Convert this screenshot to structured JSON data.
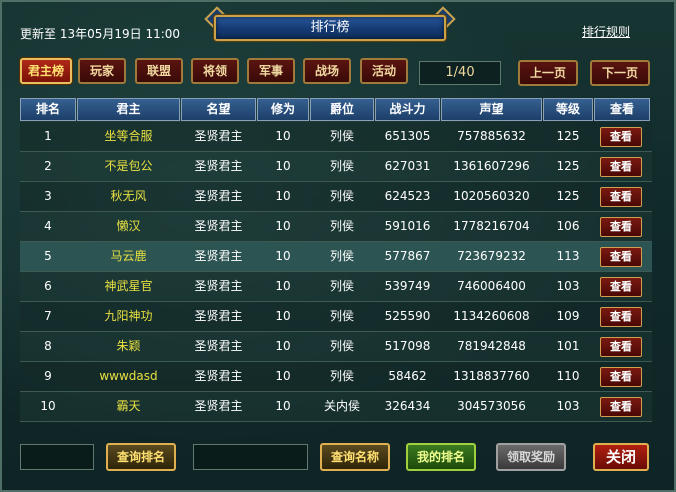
{
  "header": {
    "title": "排行榜",
    "update_text": "更新至 13年05月19日 11:00",
    "rules_link": "排行规则"
  },
  "tabs": [
    {
      "label": "君主榜",
      "active": true
    },
    {
      "label": "玩家",
      "active": false
    },
    {
      "label": "联盟",
      "active": false
    },
    {
      "label": "将领",
      "active": false
    },
    {
      "label": "军事",
      "active": false
    },
    {
      "label": "战场",
      "active": false
    },
    {
      "label": "活动",
      "active": false
    }
  ],
  "pagination": {
    "page_text": "1/40",
    "prev_label": "上一页",
    "next_label": "下一页"
  },
  "table": {
    "columns": [
      "排名",
      "君主",
      "名望",
      "修为",
      "爵位",
      "战斗力",
      "声望",
      "等级",
      "查看"
    ],
    "view_label": "查看",
    "rows": [
      {
        "rank": "1",
        "name": "坐等合服",
        "fame": "圣贤君主",
        "cultivation": "10",
        "title": "列侯",
        "power": "651305",
        "prestige": "757885632",
        "level": "125"
      },
      {
        "rank": "2",
        "name": "不是包公",
        "fame": "圣贤君主",
        "cultivation": "10",
        "title": "列侯",
        "power": "627031",
        "prestige": "1361607296",
        "level": "125"
      },
      {
        "rank": "3",
        "name": "秋无风",
        "fame": "圣贤君主",
        "cultivation": "10",
        "title": "列侯",
        "power": "624523",
        "prestige": "1020560320",
        "level": "125"
      },
      {
        "rank": "4",
        "name": "懒汉",
        "fame": "圣贤君主",
        "cultivation": "10",
        "title": "列侯",
        "power": "591016",
        "prestige": "1778216704",
        "level": "106"
      },
      {
        "rank": "5",
        "name": "马云鹿",
        "fame": "圣贤君主",
        "cultivation": "10",
        "title": "列侯",
        "power": "577867",
        "prestige": "723679232",
        "level": "113"
      },
      {
        "rank": "6",
        "name": "神武星官",
        "fame": "圣贤君主",
        "cultivation": "10",
        "title": "列侯",
        "power": "539749",
        "prestige": "746006400",
        "level": "103"
      },
      {
        "rank": "7",
        "name": "九阳神功",
        "fame": "圣贤君主",
        "cultivation": "10",
        "title": "列侯",
        "power": "525590",
        "prestige": "1134260608",
        "level": "109"
      },
      {
        "rank": "8",
        "name": "朱颖",
        "fame": "圣贤君主",
        "cultivation": "10",
        "title": "列侯",
        "power": "517098",
        "prestige": "781942848",
        "level": "101"
      },
      {
        "rank": "9",
        "name": "wwwdasd",
        "fame": "圣贤君主",
        "cultivation": "10",
        "title": "列侯",
        "power": "58462",
        "prestige": "1318837760",
        "level": "110"
      },
      {
        "rank": "10",
        "name": "霸天",
        "fame": "圣贤君主",
        "cultivation": "10",
        "title": "关内侯",
        "power": "326434",
        "prestige": "304573056",
        "level": "103"
      }
    ]
  },
  "footer": {
    "search_rank_value": "",
    "search_rank_label": "查询排名",
    "search_name_value": "",
    "search_name_label": "查询名称",
    "my_rank_label": "我的排名",
    "claim_label": "领取奖励",
    "close_label": "关闭"
  },
  "colors": {
    "name_text": "#e8e040",
    "highlight_row": "#2b5452"
  }
}
